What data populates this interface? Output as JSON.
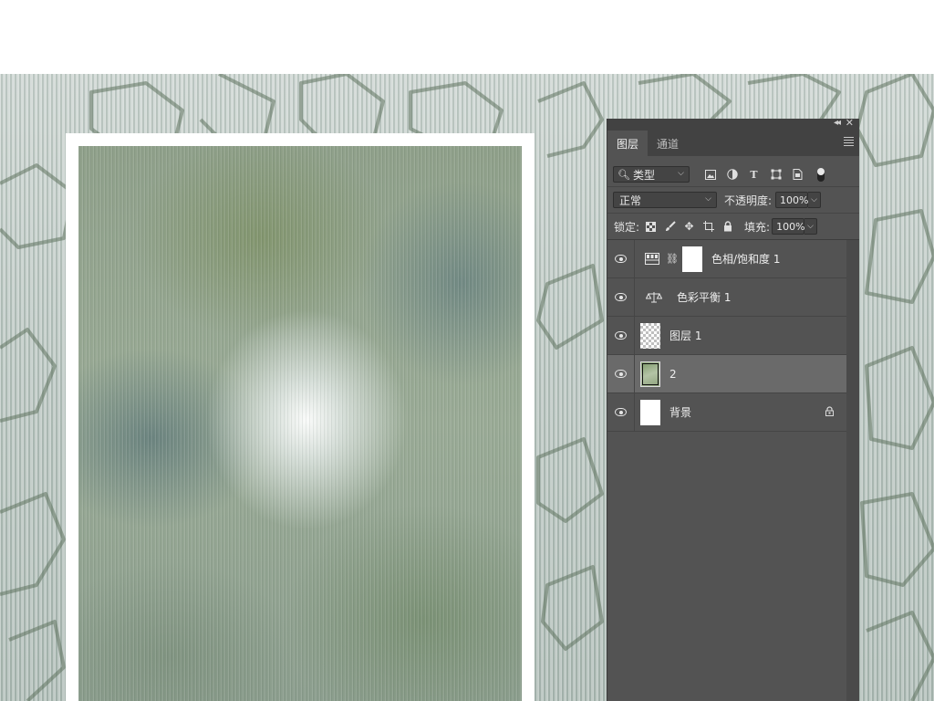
{
  "panel": {
    "tabs": [
      {
        "label": "图层"
      },
      {
        "label": "通道"
      }
    ],
    "filter": {
      "kind_label": "类型",
      "icons": [
        "image-filter-icon",
        "adjustment-filter-icon",
        "text-filter-icon",
        "shape-filter-icon",
        "smart-object-filter-icon",
        "filter-toggle"
      ]
    },
    "blend": {
      "mode": "正常",
      "opacity_label": "不透明度:",
      "opacity_value": "100%"
    },
    "lock": {
      "label": "锁定:",
      "icons": [
        "lock-transparent-icon",
        "lock-paint-icon",
        "lock-position-icon",
        "lock-artboard-icon",
        "lock-all-icon"
      ],
      "fill_label": "填充:",
      "fill_value": "100%"
    },
    "layers": [
      {
        "name": "色相/饱和度 1",
        "type": "adjustment",
        "icon": "hue-saturation-icon",
        "has_mask": true,
        "selected": false,
        "visible": true
      },
      {
        "name": "色彩平衡 1",
        "type": "adjustment",
        "icon": "color-balance-icon",
        "has_mask": false,
        "selected": false,
        "visible": true
      },
      {
        "name": "图层 1",
        "type": "pixel",
        "thumbnail": "transparent",
        "selected": false,
        "visible": true
      },
      {
        "name": "2",
        "type": "pixel",
        "thumbnail": "image",
        "selected": true,
        "visible": true
      },
      {
        "name": "背景",
        "type": "background",
        "thumbnail": "white",
        "locked": true,
        "selected": false,
        "visible": true
      }
    ]
  },
  "colors": {
    "panel_bg": "#535353",
    "panel_header": "#424242",
    "selected_row": "#6a6a6a",
    "text": "#e6e6e6"
  }
}
